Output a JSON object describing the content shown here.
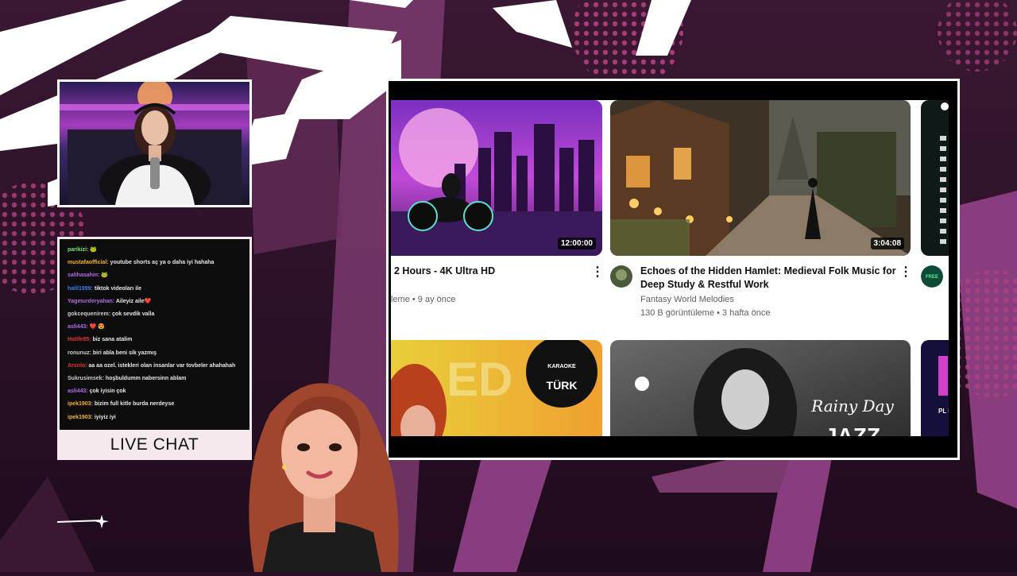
{
  "chat": {
    "label": "LIVE CHAT",
    "messages": [
      {
        "user": "parikizi:",
        "text": " 🐸",
        "color": "#7ee07e"
      },
      {
        "user": "mustafaofficial:",
        "text": " youtube shorts aç ya o daha iyi hahaha",
        "color": "#f2b233"
      },
      {
        "user": "salihasahin:",
        "text": " 🐸",
        "color": "#b06ee8"
      },
      {
        "user": "halil1999:",
        "text": " tiktok videoları ile",
        "color": "#3b7de8"
      },
      {
        "user": "Yagmurderyahan:",
        "text": " Aileyiz aile❤️",
        "color": "#b06ee8"
      },
      {
        "user": "gokcequenirem:",
        "text": " çok sevdik valla",
        "color": "#cccccc"
      },
      {
        "user": "asli443:",
        "text": " ❤️ 😍",
        "color": "#b06ee8"
      },
      {
        "user": "Hatife85:",
        "text": " biz sana atalim",
        "color": "#e03535"
      },
      {
        "user": "ronunuz:",
        "text": " biri abla beni sik yazmış",
        "color": "#cccccc"
      },
      {
        "user": "Arsnlo:",
        "text": " aa aa ozel. istekleri olan insanlar var tovbeler ahahahah",
        "color": "#e03535"
      },
      {
        "user": "Sukrusimsek:",
        "text": " hoşbuldumm nabersinn ablam",
        "color": "#cccccc"
      },
      {
        "user": "asli443:",
        "text": " çok iyisin çok",
        "color": "#b06ee8"
      },
      {
        "user": "ipek1903:",
        "text": " bizim full kitle burda nerdeyse",
        "color": "#f2b233"
      },
      {
        "user": "ipek1903:",
        "text": " iyiyiz iyi",
        "color": "#f2b233"
      }
    ]
  },
  "videos": [
    {
      "title_line1": "2 Hours - 4K Ultra HD",
      "meta_line1": "leme • 9 ay önce",
      "duration": "12:00:00"
    },
    {
      "title_line1": "Echoes of the Hidden Hamlet: Medieval Folk Music for",
      "title_line2": "Deep Study & Restful Work",
      "channel": "Fantasy World Melodies",
      "meta_line1": "130 B görüntüleme • 3 hafta önce",
      "duration": "3:04:08"
    }
  ],
  "thumb_texts": {
    "karaoke_top": "KARAOKE",
    "karaoke_brand": "TÜRK",
    "rainy": "Rainy Day",
    "jazz": "JAZZ",
    "big_letters": "ED",
    "side_text": "PL BY",
    "side_avatar": "FREE"
  },
  "kebab": "⋮",
  "colors": {
    "bg_dark": "#2a0f26",
    "accent_purple": "#8a3d7e",
    "frame_white": "#ffffff"
  }
}
